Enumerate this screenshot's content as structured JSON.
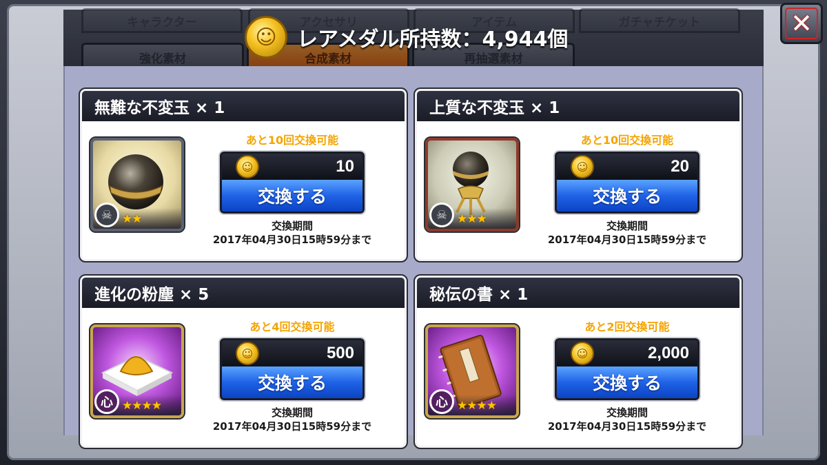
{
  "tabs_top": [
    "キャラクター",
    "アクセサリ",
    "アイテム",
    "ガチャチケット"
  ],
  "tabs_bottom": [
    "強化素材",
    "合成素材",
    "再抽選素材"
  ],
  "active_tab": "合成素材",
  "medal_header": {
    "text": "レアメダル所持数：4,944個",
    "coin_icon": "rare-medal-icon"
  },
  "close_icon": "close-icon",
  "close_symbol": "✕",
  "cards": [
    {
      "title": "無難な不変玉 × 1",
      "remaining": "あと10回交換可能",
      "price": "10",
      "button_label": "交換する",
      "period_label": "交換期間",
      "period_value": "2017年04月30日15時59分まで",
      "stars": "★★",
      "badge": "",
      "icon": "dark-orb-icon"
    },
    {
      "title": "上質な不変玉 × 1",
      "remaining": "あと10回交換可能",
      "price": "20",
      "button_label": "交換する",
      "period_label": "交換期間",
      "period_value": "2017年04月30日15時59分まで",
      "stars": "★★★",
      "badge": "",
      "icon": "orb-on-stand-icon"
    },
    {
      "title": "進化の粉塵 × 5",
      "remaining": "あと4回交換可能",
      "price": "500",
      "button_label": "交換する",
      "period_label": "交換期間",
      "period_value": "2017年04月30日15時59分まで",
      "stars": "★★★★",
      "badge": "心",
      "icon": "gold-dust-icon"
    },
    {
      "title": "秘伝の書 × 1",
      "remaining": "あと2回交換可能",
      "price": "2,000",
      "button_label": "交換する",
      "period_label": "交換期間",
      "period_value": "2017年04月30日15時59分まで",
      "stars": "★★★★",
      "badge": "心",
      "icon": "secret-book-icon"
    }
  ]
}
